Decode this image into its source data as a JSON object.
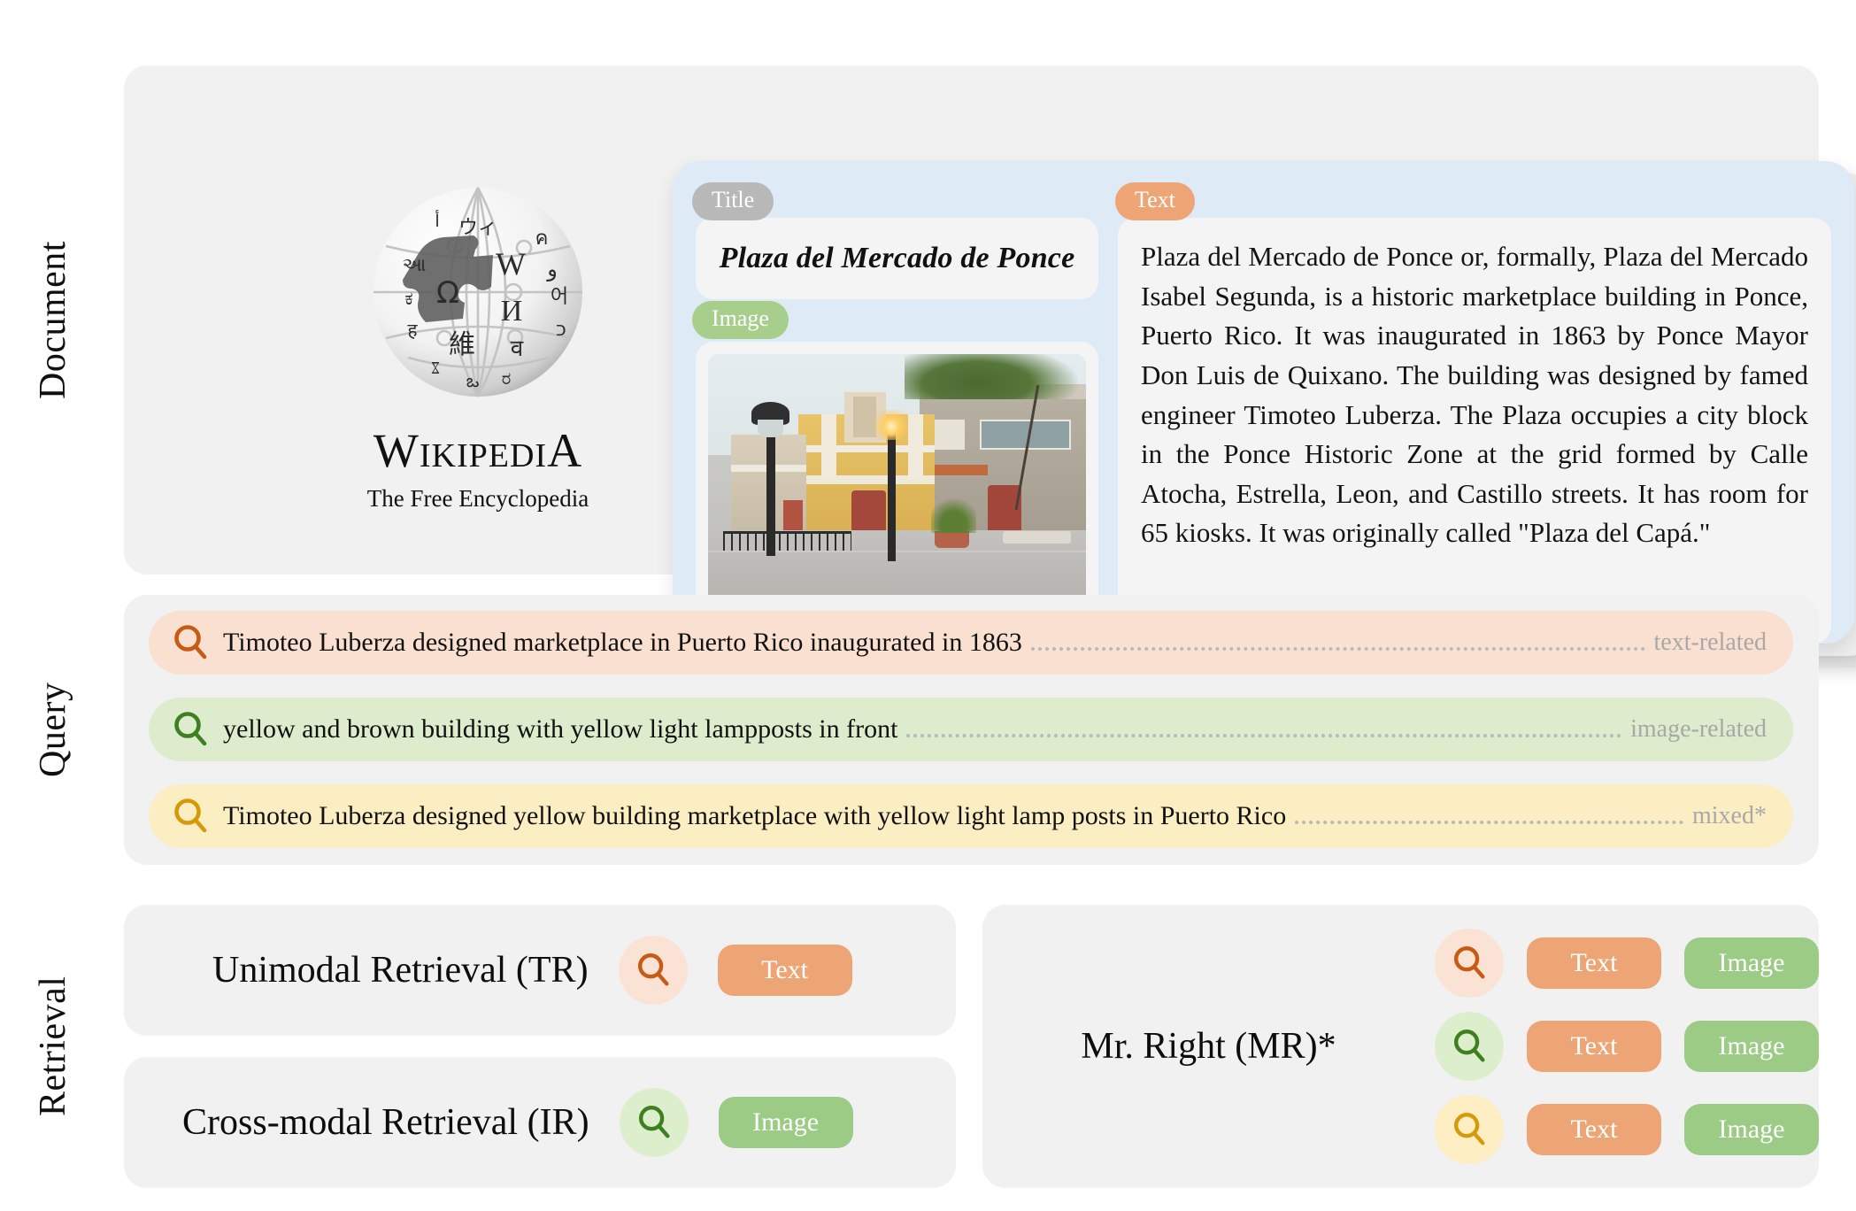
{
  "sections": {
    "document_label": "Document",
    "query_label": "Query",
    "retrieval_label": "Retrieval"
  },
  "document": {
    "source": {
      "wordmark_first": "W",
      "wordmark_rest": "IKIPEDI",
      "wordmark_last": "A",
      "tagline": "The Free Encyclopedia",
      "logo_glyphs": [
        "W",
        "Ω",
        "И",
        "維",
        "ウ",
        "ィ",
        "ა",
        "๗",
        "어",
        "श",
        "ജ",
        "ಅ",
        "ರ"
      ]
    },
    "card": {
      "title_badge": "Title",
      "title_value": "Plaza del Mercado de Ponce",
      "image_badge": "Image",
      "image_alt": "Yellow and brown marketplace building with lamp posts in front",
      "text_badge": "Text",
      "text_body": "Plaza del Mercado de Ponce or, formally, Plaza del Mercado Isabel Segunda, is a historic marketplace building in Ponce, Puerto Rico. It was inaugurated in 1863 by Ponce Mayor Don Luis de Quixano. The building was designed by famed engineer Timoteo Luberza. The Plaza occupies a city block in the Ponce Historic Zone at the grid formed by Calle Atocha, Estrella, Leon, and Castillo streets. It has room for 65 kiosks. It was originally called \"Plaza del Capá.\""
    }
  },
  "query": {
    "rows": [
      {
        "icon": "search-icon",
        "icon_color": "#c85a14",
        "background": "#f9e0d0",
        "text": "Timoteo Luberza designed marketplace in Puerto Rico inaugurated in 1863",
        "tag": "text-related"
      },
      {
        "icon": "search-icon",
        "icon_color": "#3e8021",
        "background": "#dceccd",
        "text": "yellow and brown building with yellow light lampposts in front",
        "tag": "image-related"
      },
      {
        "icon": "search-icon",
        "icon_color": "#d49a0a",
        "background": "#fceec3",
        "text": "Timoteo Luberza designed yellow building marketplace with yellow light lamp posts in Puerto Rico",
        "tag": "mixed*"
      }
    ]
  },
  "retrieval": {
    "tr": {
      "label": "Unimodal Retrieval (TR)",
      "icon_color": "#c85a14",
      "icon_bg": "#fae3d4",
      "pills": [
        "Text"
      ]
    },
    "ir": {
      "label": "Cross-modal Retrieval (IR)",
      "icon_color": "#3e8021",
      "icon_bg": "#ddeecd",
      "pills": [
        "Image"
      ]
    },
    "mr": {
      "label": "Mr. Right (MR)*",
      "rows": [
        {
          "icon_color": "#c85a14",
          "icon_bg": "#fae3d4",
          "pill_text": "Text",
          "pill_image": "Image"
        },
        {
          "icon_color": "#3e8021",
          "icon_bg": "#ddeecd",
          "pill_text": "Text",
          "pill_image": "Image"
        },
        {
          "icon_color": "#d49a0a",
          "icon_bg": "#fdeec4",
          "pill_text": "Text",
          "pill_image": "Image"
        }
      ]
    }
  },
  "colors": {
    "panel_bg": "#f1f1f1",
    "card_blue": "#dfeaf7",
    "inner_card": "#f4f4f4",
    "badge_gray": "#b8b8b8",
    "badge_green": "#a8ce8c",
    "badge_orange": "#eda575",
    "pill_text": "#eda575",
    "pill_image": "#9bcb84",
    "leader_dots": "#b9b9b9",
    "tag_text": "#a8a8a8"
  }
}
